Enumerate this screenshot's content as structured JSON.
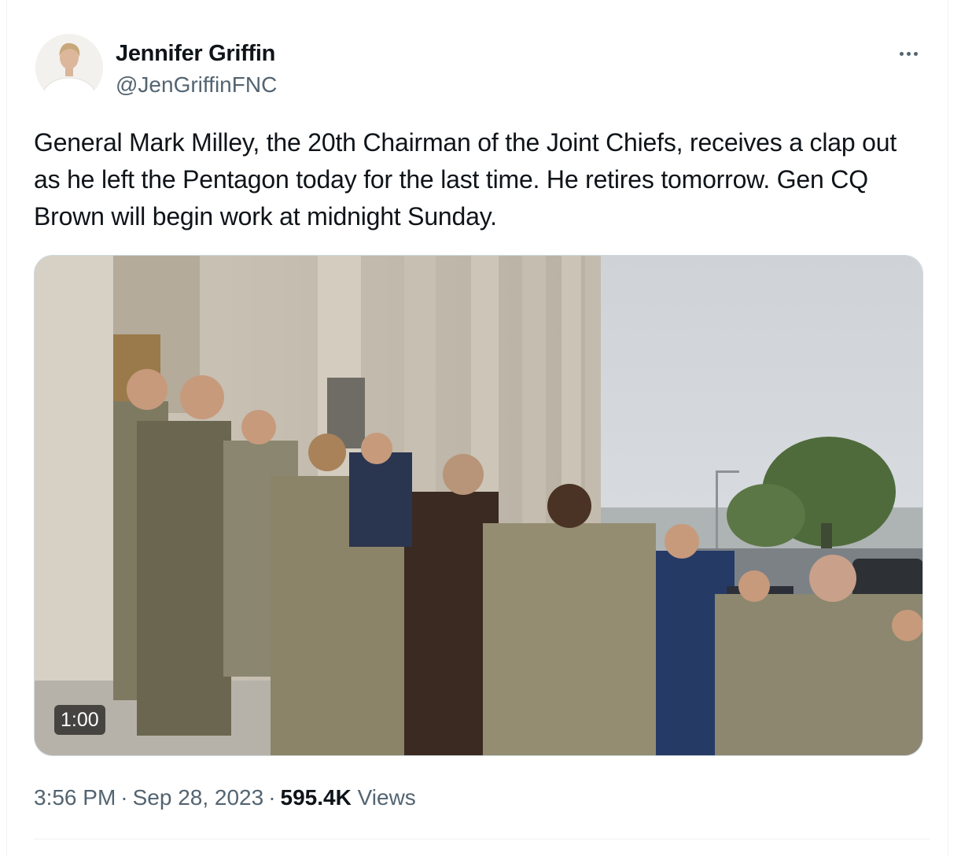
{
  "author": {
    "display_name": "Jennifer Griffin",
    "handle": "@JenGriffinFNC",
    "avatar_icon": "profile-photo"
  },
  "actions": {
    "more_icon": "ellipsis-icon"
  },
  "tweet": {
    "text": "General Mark Milley, the 20th Chairman of the Joint Chiefs, receives a clap out as he left the Pentagon today for the last time. He retires tomorrow. Gen CQ Brown will begin work at midnight Sunday."
  },
  "media": {
    "type": "video",
    "duration": "1:00"
  },
  "meta": {
    "time": "3:56 PM",
    "separator": "·",
    "date": "Sep 28, 2023",
    "views_count": "595.4K",
    "views_label": "Views"
  },
  "colors": {
    "primary_text": "#0f1419",
    "secondary_text": "#536471",
    "border": "#cfd9de",
    "divider": "#eff3f4"
  }
}
